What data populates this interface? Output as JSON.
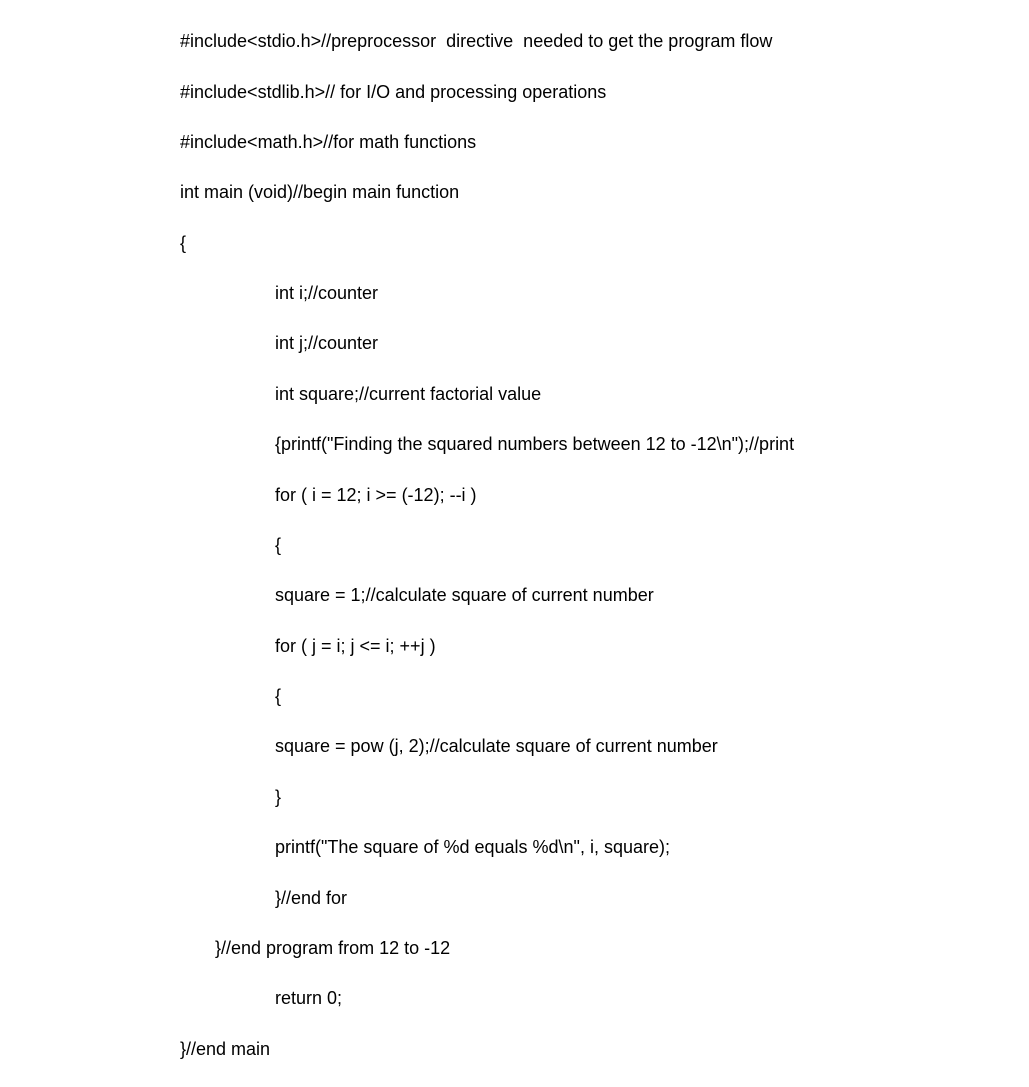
{
  "code": {
    "l1": "#include<stdio.h>//preprocessor  directive  needed to get the program flow",
    "l2": "#include<stdlib.h>// for I/O and processing operations",
    "l3": "#include<math.h>//for math functions",
    "l4": "int main (void)//begin main function",
    "l5": "{",
    "l6": "int i;//counter",
    "l7": "int j;//counter",
    "l8": "int square;//current factorial value",
    "l9": "{printf(\"Finding the squared numbers between 12 to -12\\n\");//print",
    "l10": "for ( i = 12; i >= (-12); --i )",
    "l11": "{",
    "l12": "square = 1;//calculate square of current number",
    "l13": "for ( j = i; j <= i; ++j )",
    "l14": "{",
    "l15": "square = pow (j, 2);//calculate square of current number",
    "l16": "}",
    "l17": "printf(\"The square of %d equals %d\\n\", i, square);",
    "l18": "}//end for",
    "l19": "}//end program from 12 to -12",
    "l20": "return 0;",
    "l21": "}//end main"
  }
}
